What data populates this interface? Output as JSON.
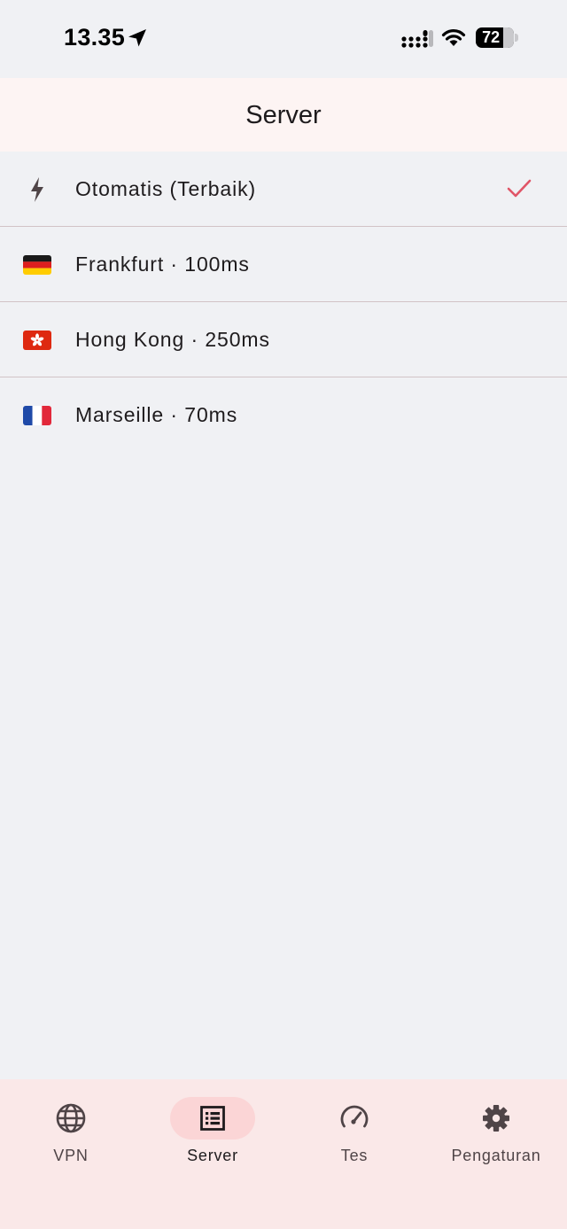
{
  "status_bar": {
    "time": "13.35",
    "battery": "72",
    "icons": [
      "location-arrow-icon",
      "cellular-signal-icon",
      "wifi-icon",
      "battery-icon"
    ]
  },
  "header": {
    "title": "Server"
  },
  "servers": [
    {
      "label": "Otomatis (Terbaik)",
      "icon": "bolt-icon",
      "selected": true
    },
    {
      "label": "Frankfurt · 100ms",
      "icon": "germany-flag-icon",
      "selected": false
    },
    {
      "label": "Hong Kong · 250ms",
      "icon": "hong-kong-flag-icon",
      "selected": false
    },
    {
      "label": "Marseille · 70ms",
      "icon": "france-flag-icon",
      "selected": false
    }
  ],
  "bottom_nav": {
    "items": [
      {
        "label": "VPN",
        "icon": "globe-icon",
        "active": false
      },
      {
        "label": "Server",
        "icon": "server-list-icon",
        "active": true
      },
      {
        "label": "Tes",
        "icon": "speedometer-icon",
        "active": false
      },
      {
        "label": "Pengaturan",
        "icon": "gear-icon",
        "active": false
      }
    ]
  },
  "colors": {
    "background": "#f0f1f4",
    "app_bar": "#fdf4f3",
    "nav_bar": "#fae8e8",
    "nav_indicator": "#fbd5d6",
    "check_accent": "#e05567",
    "divider": "#d2c3c6"
  }
}
